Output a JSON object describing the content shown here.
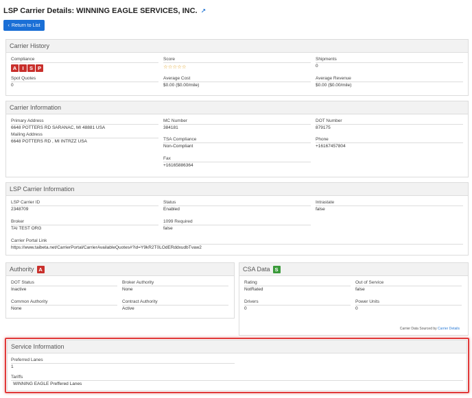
{
  "page": {
    "title": "LSP Carrier Details: WINNING EAGLE SERVICES, INC.",
    "external_icon": "external-link-icon"
  },
  "back_button": {
    "label": "Return to List",
    "icon": "chevron-left-icon"
  },
  "carrier_history": {
    "title": "Carrier History",
    "compliance_label": "Compliance",
    "compliance_badges": [
      "A",
      "I",
      "S",
      "P"
    ],
    "score_label": "Score",
    "score_stars": "☆☆☆☆☆",
    "shipments_label": "Shipments",
    "shipments_value": "0",
    "spot_quotes_label": "Spot Quotes",
    "spot_quotes_value": "0",
    "avg_cost_label": "Average Cost",
    "avg_cost_value": "$0.00 ($0.00/mile)",
    "avg_revenue_label": "Average Revenue",
    "avg_revenue_value": "$0.00 ($0.00/mile)"
  },
  "carrier_information": {
    "title": "Carrier Information",
    "primary_address_label": "Primary Address",
    "primary_address_value": "6648 POTTERS RD SARANAC, MI 48881 USA",
    "mailing_address_label": "Mailing Address",
    "mailing_address_value": "6648 POTTERS RD , MI INTRZZ USA",
    "mc_number_label": "MC Number",
    "mc_number_value": "384181",
    "tsa_label": "TSA Compliance",
    "tsa_value": "Non-Compliant",
    "fax_label": "Fax",
    "fax_value": "+16165886364",
    "dot_number_label": "DOT Number",
    "dot_number_value": "879175",
    "phone_label": "Phone",
    "phone_value": "+16167457804"
  },
  "lsp_carrier_information": {
    "title": "LSP Carrier Information",
    "carrier_id_label": "LSP Carrier ID",
    "carrier_id_value": "2348709",
    "status_label": "Status",
    "status_value": "Enabled",
    "intrastate_label": "Intrastate",
    "intrastate_value": "false",
    "broker_label": "Broker",
    "broker_value": "TAI TEST ORG",
    "required_1099_label": "1099 Required",
    "required_1099_value": "false",
    "portal_link_label": "Carrier Portal Link",
    "portal_link_value": "https://www.taibeta.net/CarrierPortal/CarrierAvailableQuotes#?id=Y9kR2T0LOdERddxudbTvaw2"
  },
  "authority": {
    "title": "Authority",
    "badge": "A",
    "dot_status_label": "DOT Status",
    "dot_status_value": "Inactive",
    "broker_authority_label": "Broker Authority",
    "broker_authority_value": "None",
    "common_authority_label": "Common Authority",
    "common_authority_value": "None",
    "contract_authority_label": "Contract Authority",
    "contract_authority_value": "Active"
  },
  "csa_data": {
    "title": "CSA Data",
    "badge": "S",
    "rating_label": "Rating",
    "rating_value": "NotRated",
    "out_of_service_label": "Out of Service",
    "out_of_service_value": "false",
    "drivers_label": "Drivers",
    "drivers_value": "0",
    "power_units_label": "Power Units",
    "power_units_value": "0",
    "sourced_text": "Carrier Data Sourced by",
    "sourced_link": "Carrier Details"
  },
  "service_information": {
    "title": "Service Information",
    "preferred_lanes_label": "Preferred Lanes",
    "preferred_lanes_value": "1",
    "tariffs_label": "Tariffs",
    "tariffs_value": "WINNING EAGLE Preffered Lanes"
  },
  "colors": {
    "accent": "#1a6fd6",
    "badge_red": "#c9302c",
    "badge_green": "#3a9a3a",
    "highlight": "#e03a3a"
  }
}
